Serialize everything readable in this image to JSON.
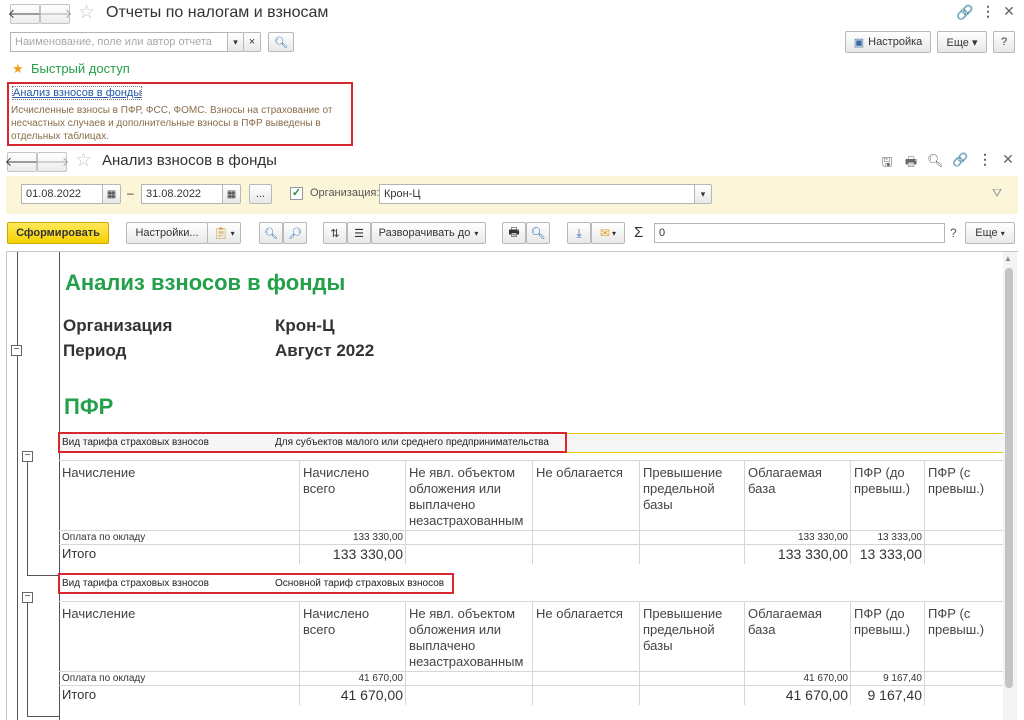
{
  "window": {
    "title": "Отчеты по налогам и взносам"
  },
  "search": {
    "placeholder": "Наименование, поле или автор отчета",
    "clear": "×",
    "dropdown": "▾"
  },
  "buttons": {
    "settings": "Настройка",
    "more": "Еще ▾",
    "help": "?"
  },
  "quick_access": {
    "label": "Быстрый доступ",
    "link": "Анализ взносов в фонды",
    "description": "Исчисленные взносы в ПФР, ФСС, ФОМС. Взносы на страхование от несчастных случаев и дополнительные взносы в ПФР выведены в отдельных таблицах."
  },
  "report_window": {
    "title": "Анализ взносов в фонды"
  },
  "filters": {
    "date_from": "01.08.2022",
    "date_to": "31.08.2022",
    "dash": "–",
    "ellipsis": "...",
    "org_label": "Организация:",
    "org_value": "Крон-Ц"
  },
  "toolbar": {
    "generate": "Сформировать",
    "settings": "Настройки...",
    "expand": "Разворачивать до",
    "sigma": "Σ",
    "sum_value": "0",
    "help": "?",
    "more": "Еще"
  },
  "report": {
    "title": "Анализ взносов в фонды",
    "org_label": "Организация",
    "org_value": "Крон-Ц",
    "period_label": "Период",
    "period_value": "Август 2022",
    "section": "ПФР",
    "headers": [
      "Начисление",
      "Начислено всего",
      "Не явл. объектом обложения или выплачено незастрахованным",
      "Не облагается",
      "Превышение предельной базы",
      "Облагаемая база",
      "ПФР (до превыш.)",
      "ПФР (с превыш.)"
    ],
    "groups": [
      {
        "tariff_label": "Вид тарифа страховых взносов",
        "tariff_value": "Для субъектов малого или среднего предпринимательства",
        "row": {
          "name": "Оплата по окладу",
          "total": "133 330,00",
          "base": "133 330,00",
          "pfr": "13 333,00"
        },
        "sum": {
          "name": "Итого",
          "total": "133 330,00",
          "base": "133 330,00",
          "pfr": "13 333,00"
        }
      },
      {
        "tariff_label": "Вид тарифа страховых взносов",
        "tariff_value": "Основной тариф страховых взносов",
        "row": {
          "name": "Оплата по окладу",
          "total": "41 670,00",
          "base": "41 670,00",
          "pfr": "9 167,40"
        },
        "sum": {
          "name": "Итого",
          "total": "41 670,00",
          "base": "41 670,00",
          "pfr": "9 167,40"
        }
      }
    ]
  },
  "colors": {
    "green": "#23a04a",
    "red": "#d9272e",
    "yellow": "#f5d200",
    "filter_bg": "#fbf6d8"
  }
}
